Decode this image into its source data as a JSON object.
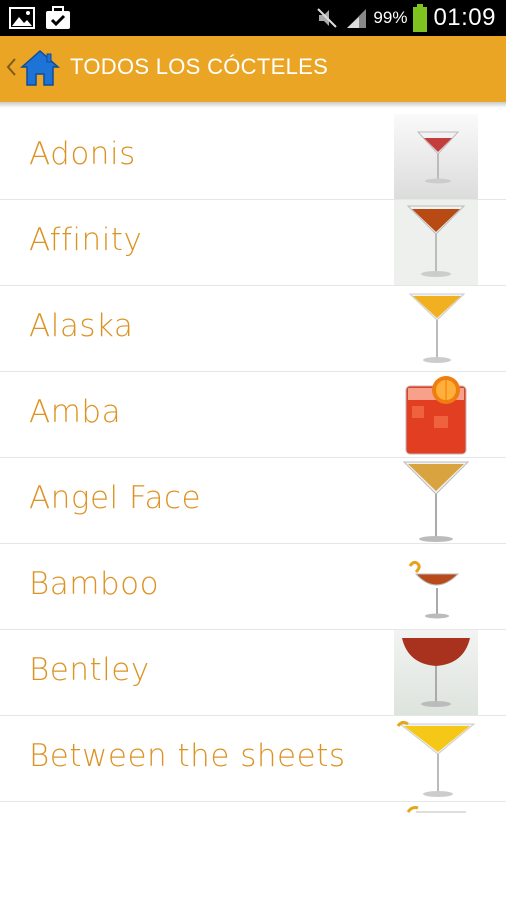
{
  "status_bar": {
    "battery_pct": "99%",
    "clock": "01:09",
    "icons": [
      "gallery-icon",
      "task-check-icon",
      "mute-icon",
      "signal-icon",
      "battery-icon"
    ]
  },
  "action_bar": {
    "title": "TODOS LOS CÓCTELES",
    "icons": [
      "chevron-left-icon",
      "home-icon"
    ],
    "accent": "#eba524"
  },
  "list": {
    "label_color": "#dd9323",
    "items": [
      {
        "label": "Adonis",
        "drink": "pink martini"
      },
      {
        "label": "Affinity",
        "drink": "amber martini"
      },
      {
        "label": "Alaska",
        "drink": "yellow martini"
      },
      {
        "label": "Amba",
        "drink": "red rocks with orange"
      },
      {
        "label": "Angel Face",
        "drink": "golden martini"
      },
      {
        "label": "Bamboo",
        "drink": "amber coupe with twist"
      },
      {
        "label": "Bentley",
        "drink": "red coupe"
      },
      {
        "label": "Between the sheets",
        "drink": "yellow martini with twist"
      }
    ]
  }
}
